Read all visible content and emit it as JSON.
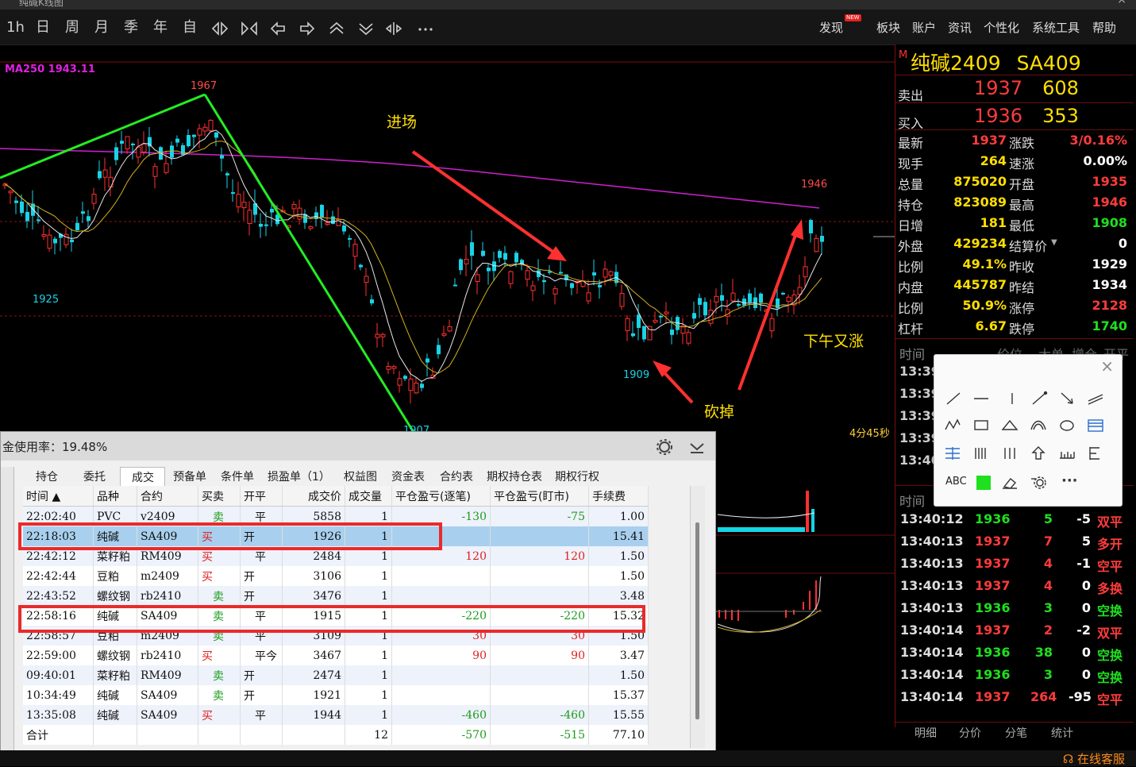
{
  "window": {
    "title": "纯碱K线图",
    "close": "×"
  },
  "toolbar": {
    "periods": [
      "1h",
      "日",
      "周",
      "月",
      "季",
      "年",
      "自"
    ],
    "icons": [
      "zoom-in-icon",
      "zoom-out-icon",
      "arrow-left-icon",
      "arrow-right-icon",
      "chevron-up-icon",
      "chevron-down-icon",
      "split-icon",
      "more-icon"
    ],
    "menu": [
      "发现",
      "板块",
      "账户",
      "资讯",
      "个性化",
      "系统工具",
      "帮助"
    ],
    "new_badge": "NEW"
  },
  "chart": {
    "ma_label": "MA250  1943.11",
    "price_labels": {
      "high_left": "1967",
      "low_left": "1925",
      "low_mid": "1909",
      "high_right": "1946",
      "bottom": "1907"
    },
    "annotations": {
      "entry": "进场",
      "cut": "砍掉",
      "afternoon": "下午又涨"
    },
    "timer": "4分45秒",
    "colors": {
      "up": "#ff3030",
      "down": "#19d3e6",
      "ma250": "#d020d0",
      "trend": "#22ee22",
      "arrow": "#ff3030"
    }
  },
  "quote": {
    "flag": "M",
    "name": "纯碱2409",
    "code": "SA409",
    "sell": {
      "label": "卖出",
      "price": "1937",
      "vol": "608"
    },
    "buy": {
      "label": "买入",
      "price": "1936",
      "vol": "353"
    },
    "rows": [
      {
        "l1": "最新",
        "v1": "1937",
        "c1": "red",
        "l2": "涨跌",
        "v2": "3/0.16%",
        "c2": "red"
      },
      {
        "l1": "现手",
        "v1": "264",
        "c1": "yel",
        "l2": "速涨",
        "v2": "0.00%",
        "c2": "wht"
      },
      {
        "l1": "总量",
        "v1": "875020",
        "c1": "yel",
        "l2": "开盘",
        "v2": "1935",
        "c2": "red"
      },
      {
        "l1": "持仓",
        "v1": "823089",
        "c1": "yel",
        "l2": "最高",
        "v2": "1946",
        "c2": "red"
      },
      {
        "l1": "日增",
        "v1": "181",
        "c1": "yel",
        "l2": "最低",
        "v2": "1908",
        "c2": "green"
      },
      {
        "l1": "外盘",
        "v1": "429234",
        "c1": "yel",
        "l2": "结算价",
        "v2": "0",
        "c2": "wht"
      },
      {
        "l1": "比例",
        "v1": "49.1%",
        "c1": "yel",
        "l2": "昨收",
        "v2": "1929",
        "c2": "wht"
      },
      {
        "l1": "内盘",
        "v1": "445787",
        "c1": "yel",
        "l2": "昨结",
        "v2": "1934",
        "c2": "wht"
      },
      {
        "l1": "比例",
        "v1": "50.9%",
        "c1": "yel",
        "l2": "涨停",
        "v2": "2128",
        "c2": "red"
      },
      {
        "l1": "杠杆",
        "v1": "6.67",
        "c1": "yel",
        "l2": "跌停",
        "v2": "1740",
        "c2": "green"
      }
    ],
    "upper_times_header": [
      "时间",
      "价位",
      "大单",
      "增仓",
      "开平"
    ],
    "upper_times": [
      "13:39",
      "13:39",
      "13:39",
      "13:39",
      "13:40"
    ],
    "tick_header": "时间",
    "ticks": [
      {
        "t": "13:40:12",
        "p": "1936",
        "v": "5",
        "oi": "-5",
        "k": "双平",
        "cv": "green",
        "ck": "red"
      },
      {
        "t": "13:40:13",
        "p": "1937",
        "v": "7",
        "oi": "5",
        "k": "多开",
        "cv": "red",
        "ck": "red"
      },
      {
        "t": "13:40:13",
        "p": "1937",
        "v": "4",
        "oi": "-1",
        "k": "空平",
        "cv": "red",
        "ck": "red"
      },
      {
        "t": "13:40:13",
        "p": "1937",
        "v": "4",
        "oi": "0",
        "k": "多换",
        "cv": "red",
        "ck": "red"
      },
      {
        "t": "13:40:13",
        "p": "1936",
        "v": "3",
        "oi": "0",
        "k": "空换",
        "cv": "green",
        "ck": "green"
      },
      {
        "t": "13:40:14",
        "p": "1937",
        "v": "2",
        "oi": "-2",
        "k": "双平",
        "cv": "red",
        "ck": "red"
      },
      {
        "t": "13:40:14",
        "p": "1936",
        "v": "38",
        "oi": "0",
        "k": "空换",
        "cv": "green",
        "ck": "green"
      },
      {
        "t": "13:40:14",
        "p": "1936",
        "v": "3",
        "oi": "0",
        "k": "空换",
        "cv": "green",
        "ck": "green"
      },
      {
        "t": "13:40:14",
        "p": "1937",
        "v": "264",
        "oi": "-95",
        "k": "空平",
        "cv": "red",
        "ck": "red"
      }
    ],
    "bottom_tabs": [
      "明细",
      "分价",
      "分笔",
      "统计"
    ]
  },
  "tools": {
    "close": "×",
    "labels": {
      "text": "ABC",
      "more": "···"
    },
    "icons": [
      "line-segment-icon",
      "horizontal-line-icon",
      "vertical-line-icon",
      "ray-icon",
      "arrow-line-icon",
      "parallel-lines-icon",
      "polyline-icon",
      "rectangle-icon",
      "triangle-icon",
      "arc-icon",
      "ellipse-icon",
      "fibonacci-icon",
      "price-channel-icon",
      "multi-vertical-icon",
      "triple-line-icon",
      "up-arrow-icon",
      "ruler-icon",
      "fib-extension-icon",
      "text-icon",
      "color-swatch-icon",
      "eraser-icon",
      "settings-icon",
      "more-icon"
    ]
  },
  "orders": {
    "margin": "金使用率：19.48%",
    "tabs": [
      "持仓",
      "委托",
      "成交",
      "预备单",
      "条件单",
      "损盈单（1）",
      "权益图",
      "资金表",
      "合约表",
      "期权持仓表",
      "期权行权"
    ],
    "active_tab": "成交",
    "columns": [
      "时间 ▲",
      "品种",
      "合约",
      "买卖",
      "开平",
      "成交价",
      "成交量",
      "平仓盈亏(逐笔)",
      "平仓盈亏(盯市)",
      "手续费"
    ],
    "rows": [
      {
        "time": "22:02:40",
        "prod": "PVC",
        "contract": "v2409",
        "side": "卖",
        "oc": "平",
        "price": "5858",
        "qty": "1",
        "pnl1": "-130",
        "pnl2": "-75",
        "fee": "1.00"
      },
      {
        "time": "22:18:03",
        "prod": "纯碱",
        "contract": "SA409",
        "side": "买",
        "oc": "开",
        "price": "1926",
        "qty": "1",
        "pnl1": "",
        "pnl2": "",
        "fee": "15.41"
      },
      {
        "time": "22:42:12",
        "prod": "菜籽粕",
        "contract": "RM409",
        "side": "买",
        "oc": "平",
        "price": "2484",
        "qty": "1",
        "pnl1": "120",
        "pnl2": "120",
        "fee": "1.50"
      },
      {
        "time": "22:42:44",
        "prod": "豆粕",
        "contract": "m2409",
        "side": "买",
        "oc": "开",
        "price": "3106",
        "qty": "1",
        "pnl1": "",
        "pnl2": "",
        "fee": "1.50"
      },
      {
        "time": "22:43:52",
        "prod": "螺纹钢",
        "contract": "rb2410",
        "side": "卖",
        "oc": "开",
        "price": "3476",
        "qty": "1",
        "pnl1": "",
        "pnl2": "",
        "fee": "3.48"
      },
      {
        "time": "22:58:16",
        "prod": "纯碱",
        "contract": "SA409",
        "side": "卖",
        "oc": "平",
        "price": "1915",
        "qty": "1",
        "pnl1": "-220",
        "pnl2": "-220",
        "fee": "15.32"
      },
      {
        "time": "22:58:57",
        "prod": "豆粕",
        "contract": "m2409",
        "side": "卖",
        "oc": "平",
        "price": "3109",
        "qty": "1",
        "pnl1": "30",
        "pnl2": "30",
        "fee": "1.50"
      },
      {
        "time": "22:59:00",
        "prod": "螺纹钢",
        "contract": "rb2410",
        "side": "买",
        "oc": "平今",
        "price": "3467",
        "qty": "1",
        "pnl1": "90",
        "pnl2": "90",
        "fee": "3.47"
      },
      {
        "time": "09:40:01",
        "prod": "菜籽粕",
        "contract": "RM409",
        "side": "卖",
        "oc": "开",
        "price": "2474",
        "qty": "1",
        "pnl1": "",
        "pnl2": "",
        "fee": "1.50"
      },
      {
        "time": "10:34:49",
        "prod": "纯碱",
        "contract": "SA409",
        "side": "卖",
        "oc": "开",
        "price": "1921",
        "qty": "1",
        "pnl1": "",
        "pnl2": "",
        "fee": "15.37"
      },
      {
        "time": "13:35:08",
        "prod": "纯碱",
        "contract": "SA409",
        "side": "买",
        "oc": "平",
        "price": "1944",
        "qty": "1",
        "pnl1": "-460",
        "pnl2": "-460",
        "fee": "15.55"
      }
    ],
    "total": {
      "label": "合计",
      "qty": "12",
      "pnl1": "-570",
      "pnl2": "-515",
      "fee": "77.10"
    }
  },
  "status": {
    "service": "在线客服"
  }
}
